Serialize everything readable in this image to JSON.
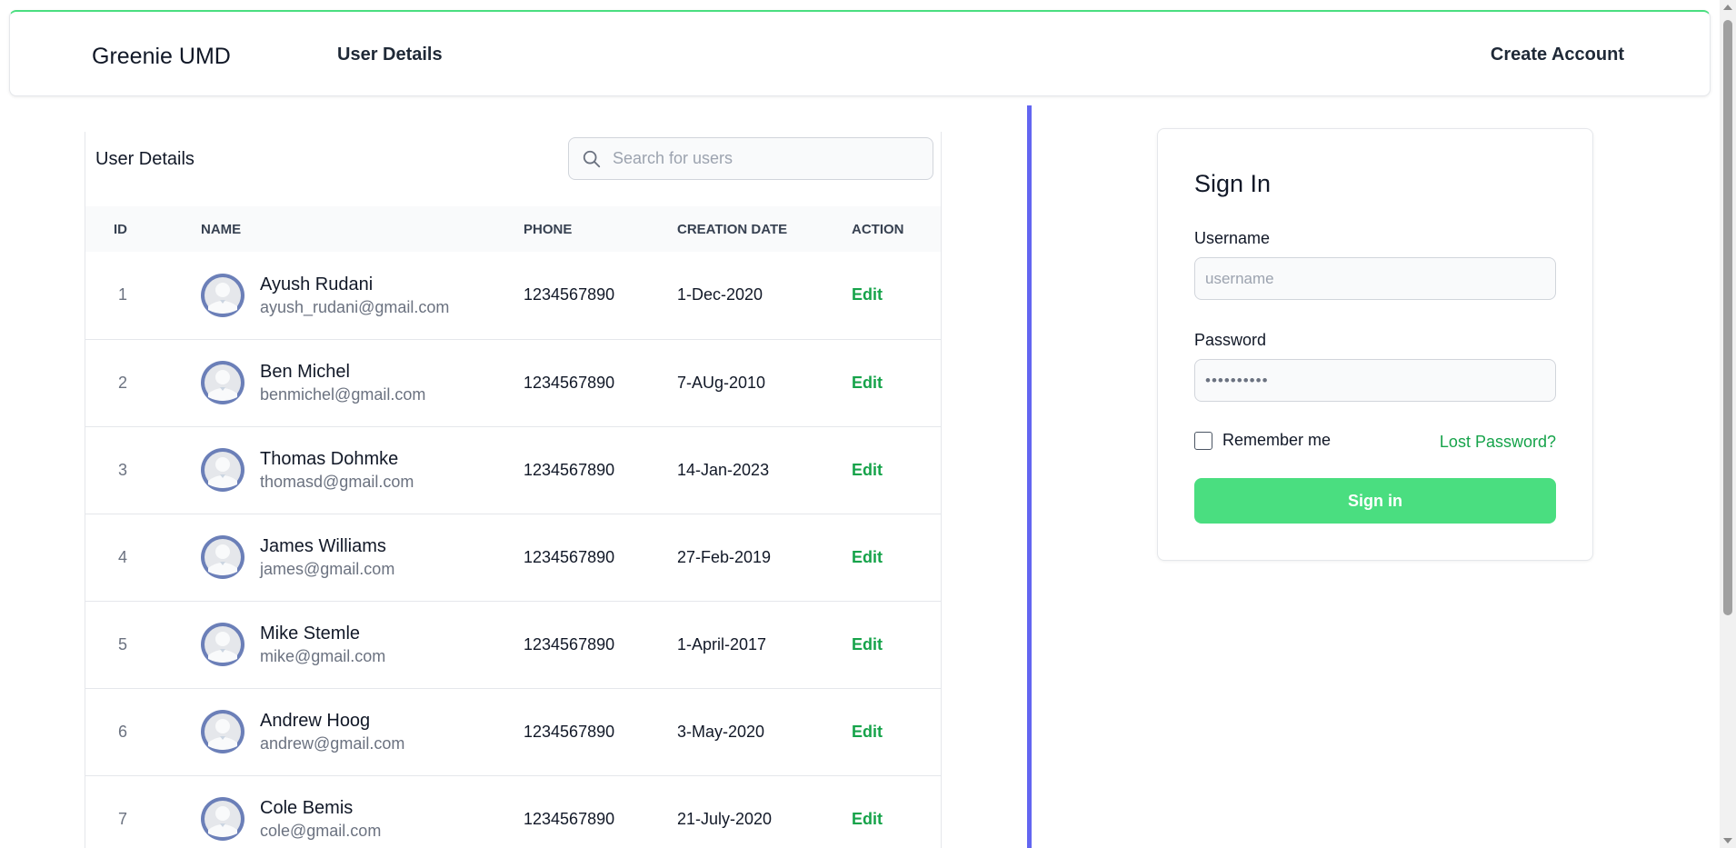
{
  "navbar": {
    "brand": "Greenie UMD",
    "links": {
      "user_details": "User Details",
      "create_account": "Create Account"
    }
  },
  "users_panel": {
    "title": "User Details",
    "search": {
      "placeholder": "Search for users",
      "value": ""
    },
    "columns": [
      "ID",
      "NAME",
      "PHONE",
      "CREATION DATE",
      "ACTION"
    ],
    "rows": [
      {
        "id": "1",
        "name": "Ayush Rudani",
        "email": "ayush_rudani@gmail.com",
        "phone": "1234567890",
        "created": "1-Dec-2020",
        "action": "Edit"
      },
      {
        "id": "2",
        "name": "Ben Michel",
        "email": "benmichel@gmail.com",
        "phone": "1234567890",
        "created": "7-AUg-2010",
        "action": "Edit"
      },
      {
        "id": "3",
        "name": "Thomas Dohmke",
        "email": "thomasd@gmail.com",
        "phone": "1234567890",
        "created": "14-Jan-2023",
        "action": "Edit"
      },
      {
        "id": "4",
        "name": "James Williams",
        "email": "james@gmail.com",
        "phone": "1234567890",
        "created": "27-Feb-2019",
        "action": "Edit"
      },
      {
        "id": "5",
        "name": "Mike Stemle",
        "email": "mike@gmail.com",
        "phone": "1234567890",
        "created": "1-April-2017",
        "action": "Edit"
      },
      {
        "id": "6",
        "name": "Andrew Hoog",
        "email": "andrew@gmail.com",
        "phone": "1234567890",
        "created": "3-May-2020",
        "action": "Edit"
      },
      {
        "id": "7",
        "name": "Cole Bemis",
        "email": "cole@gmail.com",
        "phone": "1234567890",
        "created": "21-July-2020",
        "action": "Edit"
      }
    ]
  },
  "signin": {
    "title": "Sign In",
    "username_label": "Username",
    "username_placeholder": "username",
    "password_label": "Password",
    "password_value": "••••••••••",
    "remember_label": "Remember me",
    "remember_checked": false,
    "lost_password": "Lost Password?",
    "submit_label": "Sign in"
  },
  "icons": {
    "search": "search-icon",
    "avatar": "user-avatar-icon"
  },
  "colors": {
    "accent_green": "#4ade80",
    "link_green": "#16a34a",
    "divider_indigo": "#6366f1",
    "avatar_blue": "#6b7fb8"
  }
}
